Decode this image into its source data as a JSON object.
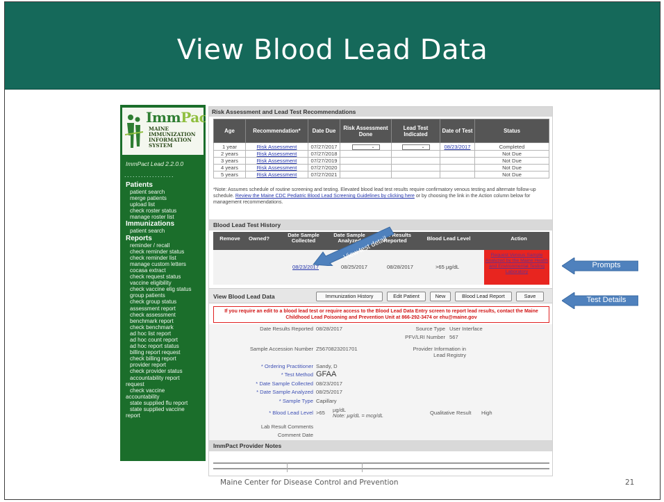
{
  "slide": {
    "title": "View Blood Lead Data",
    "footer_org": "Maine Center for Disease Control and Prevention",
    "page_number": "21"
  },
  "sidebar": {
    "brand_a": "Imm",
    "brand_b": "Pact",
    "system_lines": [
      "MAINE",
      "IMMUNIZATION",
      "INFORMATION",
      "SYSTEM"
    ],
    "version": "ImmPact Lead 2.2.0.0",
    "sections": [
      {
        "title": "Patients",
        "items": [
          "patient search",
          "merge patients",
          "upload list",
          "check roster status",
          "manage roster list"
        ]
      },
      {
        "title": "Immunizations",
        "items": [
          "patient search"
        ]
      },
      {
        "title": "Reports",
        "items": [
          "reminder / recall",
          "check reminder status",
          "check reminder list",
          "manage custom letters",
          "cocasa extract",
          "check request status",
          "vaccine eligibility",
          "check vaccine elig status",
          "group patients",
          "check group status",
          "assessment report",
          "check assessment",
          "benchmark report",
          "check benchmark",
          "ad hoc list report",
          "ad hoc count report",
          "ad hoc report status",
          "billing report request",
          "check billing report",
          "provider report",
          "check provider status",
          "accountability report",
          "request",
          "check vaccine",
          "accountability",
          "state supplied flu report",
          "state supplied vaccine",
          "report"
        ]
      }
    ]
  },
  "risk": {
    "header": "Risk Assessment and Lead Test Recommendations",
    "columns": [
      "Age",
      "Recommendation*",
      "Date Due",
      "Risk Assessment Done",
      "Lead Test Indicated",
      "Date of Test",
      "Status"
    ],
    "rows": [
      {
        "age": "1 year",
        "rec": "Risk Assessment",
        "due": "07/27/2017",
        "done": "",
        "ind": "",
        "test": "08/23/2017",
        "status": "Completed"
      },
      {
        "age": "2 years",
        "rec": "Risk Assessment",
        "due": "07/27/2018",
        "done": "",
        "ind": "",
        "test": "",
        "status": "Not Due"
      },
      {
        "age": "3 years",
        "rec": "Risk Assessment",
        "due": "07/27/2019",
        "done": "",
        "ind": "",
        "test": "",
        "status": "Not Due"
      },
      {
        "age": "4 years",
        "rec": "Risk Assessment",
        "due": "07/27/2020",
        "done": "",
        "ind": "",
        "test": "",
        "status": "Not Due"
      },
      {
        "age": "5 years",
        "rec": "Risk Assessment",
        "due": "07/27/2021",
        "done": "",
        "ind": "",
        "test": "",
        "status": "Not Due"
      }
    ],
    "note_a": "*Note: Assumes schedule of routine screening and testing. Elevated blood lead test results require confirmatory venous testing and alternate follow-up schedule. ",
    "note_link": "Review the Maine CDC Pediatric Blood Lead Screening Guidelines by clicking here",
    "note_b": " or by choosing the link in the Action column below for management recommendations."
  },
  "history": {
    "header": "Blood Lead Test History",
    "columns": [
      "Remove",
      "Owned?",
      "Date Sample Collected",
      "Date Sample Analyzed",
      "Date Results Reported",
      "Blood Lead Level",
      "Action"
    ],
    "row": {
      "collected": "08/23/2017",
      "analyzed": "08/25/2017",
      "reported": "08/28/2017",
      "level": ">65 µg/dL"
    },
    "action": "Request Venous Sample Analyzed by the Maine Health and Environmental Testing Laboratory"
  },
  "buttonbar": {
    "label": "View Blood Lead Data",
    "buttons": [
      "Immunization History",
      "Edit Patient",
      "New",
      "Blood Lead Report",
      "Save"
    ]
  },
  "warning": "If you require an edit to a blood lead test or require access to the Blood Lead Data Entry screen to report lead results, contact the Maine Childhood Lead Poisoning and Prevention Unit at 866-292-3474 or ehu@maine.gov",
  "details": {
    "date_reported_label": "Date Results Reported",
    "date_reported": "08/28/2017",
    "source_type_label": "Source Type",
    "source_type": "User Interface",
    "pfv_label": "PFV/LRI Number",
    "pfv": "567",
    "accession_label": "Sample Accession Number",
    "accession": "Z5670823201701",
    "provider_info_label": "Provider Information in Lead Registry",
    "ordering_label": "* Ordering Practitioner",
    "ordering": "Sandy, D",
    "method_label": "* Test Method",
    "method": "GFAA",
    "collected_label": "* Date Sample Collected",
    "collected": "08/23/2017",
    "analyzed_label": "* Date Sample Analyzed",
    "analyzed": "08/25/2017",
    "type_label": "* Sample Type",
    "type": "Capillary",
    "level_label": "* Blood Lead Level",
    "level_op": ">65",
    "level_unit": "µg/dL",
    "level_note": "Note: µg/dL = mcg/dL",
    "qual_label": "Qualitative Result",
    "qual": "High",
    "lab_comments_label": "Lab Result Comments",
    "comment_date_label": "Comment Date"
  },
  "notes_header": "ImmPact Provider Notes",
  "annotations": {
    "view_test_detail": "View test detail",
    "prompts": "Prompts",
    "test_details": "Test Details"
  },
  "colors": {
    "title_bar": "#15695a",
    "sidebar": "#1b6e2b",
    "callout": "#4f81bd",
    "action_red": "#e8251f"
  }
}
